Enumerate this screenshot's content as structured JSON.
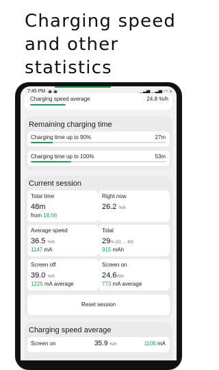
{
  "headline": [
    "Charging speed",
    "and other",
    "statistics"
  ],
  "status_bar": {
    "time": "7:45 PM",
    "battery": "⚡"
  },
  "top_card": {
    "label": "Charging speed average",
    "value": "24.8 %/h"
  },
  "remaining": {
    "title": "Remaining charging time",
    "rows": [
      {
        "label": "Charging time up to 90%",
        "value": "27m",
        "progress": 0.16
      },
      {
        "label": "Charging time up to 100%",
        "value": "53m",
        "progress": 0.3
      }
    ]
  },
  "session": {
    "title": "Current session",
    "total_time": {
      "title": "Total time",
      "value": "48m",
      "sub_prefix": "from ",
      "sub_value": "18:56"
    },
    "right_now": {
      "title": "Right now",
      "value": "26.2",
      "unit": "%/h"
    },
    "avg_speed": {
      "title": "Average speed",
      "value": "36.5",
      "unit": "%/h",
      "sub_value": "1147",
      "sub_suffix": " mA"
    },
    "total": {
      "title": "Total",
      "value": "29",
      "unit": "% (31 → 80)",
      "sub_value": "915",
      "sub_suffix": " mAh"
    },
    "screen_off": {
      "title": "Screen off",
      "value": "39.0",
      "unit": "%/h",
      "sub_value": "1225",
      "sub_suffix": " mA average"
    },
    "screen_on": {
      "title": "Screen on",
      "value": "24.6",
      "unit": "%/h",
      "sub_value": "773",
      "sub_suffix": " mA average"
    },
    "reset_label": "Reset session"
  },
  "speed_avg": {
    "title": "Charging speed average",
    "row": {
      "label": "Screen on",
      "value": "35.9",
      "unit": "%/h",
      "ma_value": "1106",
      "ma_suffix": " mA"
    }
  },
  "colors": {
    "accent": "#16a34a",
    "phone": "#111111",
    "section": "#ebebeb"
  }
}
